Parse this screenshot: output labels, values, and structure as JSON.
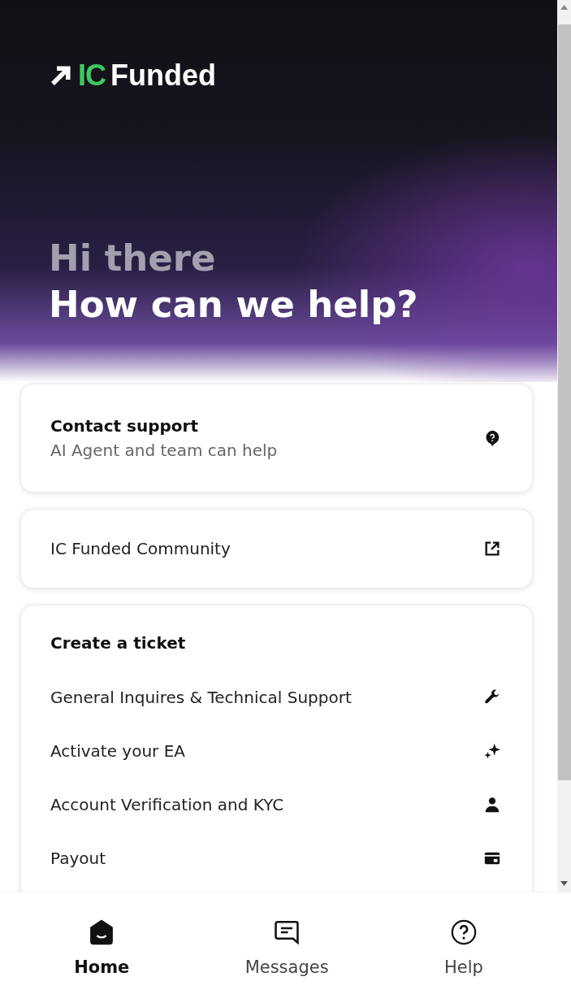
{
  "logo": {
    "accent": "IC",
    "name": "Funded"
  },
  "greeting": {
    "line_1": "Hi there",
    "line_2": "How can we help?"
  },
  "contact_card": {
    "title": "Contact support",
    "subtitle": "AI Agent and team can help"
  },
  "community_link": {
    "label": "IC Funded Community"
  },
  "ticket_card": {
    "title": "Create a ticket",
    "items": [
      {
        "label": "General Inquires & Technical Support"
      },
      {
        "label": "Activate your EA"
      },
      {
        "label": "Account Verification and KYC"
      },
      {
        "label": "Payout"
      }
    ]
  },
  "nav_tabs": [
    {
      "label": "Home",
      "selected": true
    },
    {
      "label": "Messages",
      "selected": false
    },
    {
      "label": "Help",
      "selected": false
    }
  ]
}
